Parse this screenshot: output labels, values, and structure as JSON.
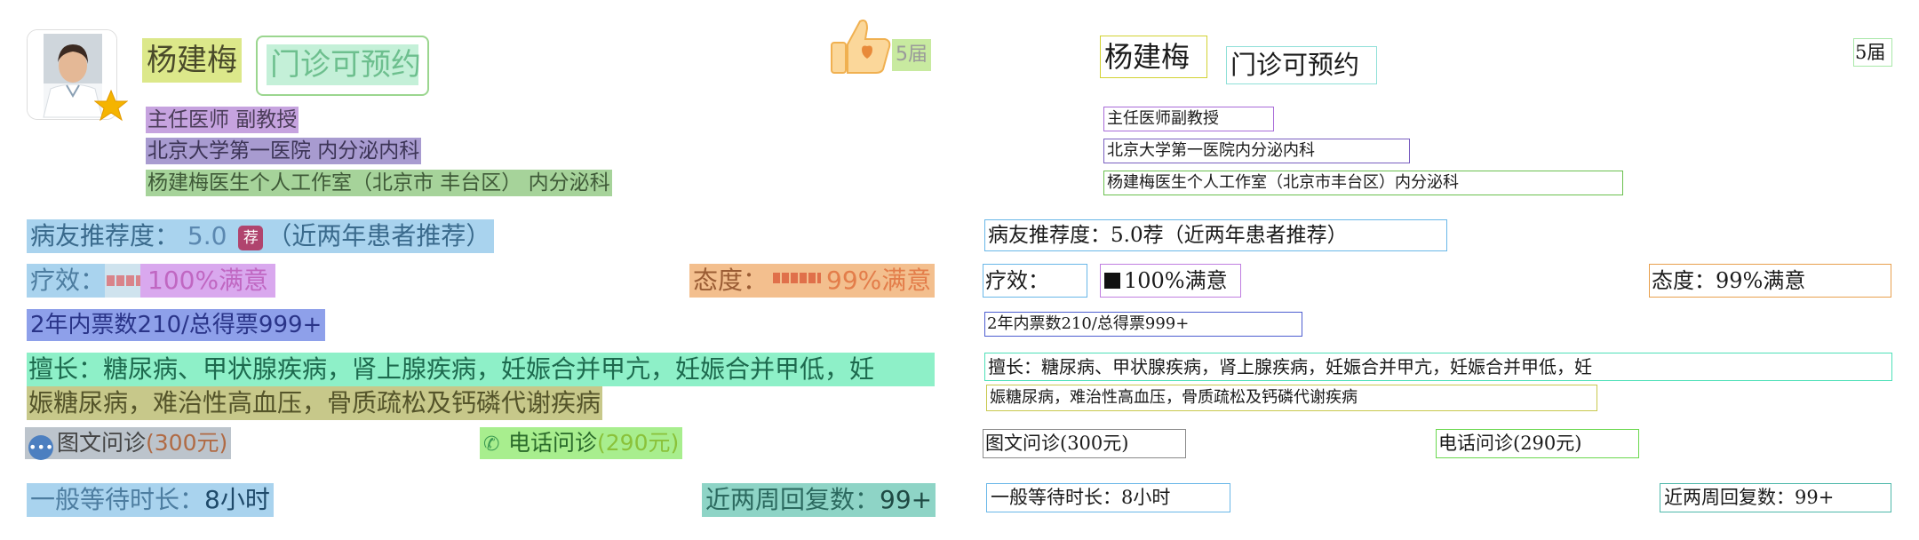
{
  "doctor": {
    "name": "杨建梅",
    "availability": "门诊可预约",
    "terms": "5届",
    "title": "主任医师 副教授",
    "hospital": "北京大学第一医院 内分泌内科",
    "studio": "杨建梅医生个人工作室（北京市 丰台区） 内分泌科"
  },
  "rating": {
    "label": "病友推荐度：",
    "score": "5.0",
    "tag": "荐",
    "note": "（近两年患者推荐）"
  },
  "efficacy": {
    "label": "疗效：",
    "value": "100%满意"
  },
  "attitude": {
    "label": "态度：",
    "value": "99%满意"
  },
  "votes": "2年内票数210/总得票999+",
  "specialty": {
    "line1": "擅长：糖尿病、甲状腺疾病，肾上腺疾病，妊娠合并甲亢，妊娠合并甲低，妊",
    "line2": "娠糖尿病，难治性高血压，骨质疏松及钙磷代谢疾病"
  },
  "services": {
    "image_text": {
      "label": "图文问诊",
      "price": "(300元)"
    },
    "phone": {
      "label": "电话问诊",
      "price": "(290元)"
    }
  },
  "stats": {
    "wait_label": "一般等待时长：",
    "wait_value": "8小时",
    "reply_label": "近两周回复数：",
    "reply_value": "99+"
  },
  "wireframe": {
    "name": "杨建梅",
    "availability": "门诊可预约",
    "terms": "5届",
    "title": "主任医师副教授",
    "hospital": "北京大学第一医院内分泌内科",
    "studio": "杨建梅医生个人工作室（北京市丰台区）内分泌科",
    "rating": "病友推荐度：5.0荐（近两年患者推荐）",
    "efficacy_label": "疗效：",
    "efficacy_value": "100%满意",
    "attitude": "态度：99%满意",
    "votes": "2年内票数210/总得票999+",
    "specialty1": "擅长：糖尿病、甲状腺疾病，肾上腺疾病，妊娠合并甲亢，妊娠合并甲低，妊",
    "specialty2": "娠糖尿病，难治性高血压，骨质疏松及钙磷代谢疾病",
    "image_text": "图文问诊(300元)",
    "phone": "电话问诊(290元)",
    "wait": "一般等待时长：8小时",
    "reply": "近两周回复数：99+"
  },
  "icons": {
    "avatar": "doctor-photo",
    "star": "star-icon",
    "thumb": "thumbs-up-icon",
    "chat": "chat-bubble-icon",
    "phone": "phone-icon"
  },
  "colors": {
    "name_highlight": "#dce88a",
    "availability_highlight": "#c4f0d8",
    "rating_highlight": "#a9d3ee",
    "attitude_highlight": "#f3bf8e",
    "specialty_highlight": "#8ef0c8"
  }
}
